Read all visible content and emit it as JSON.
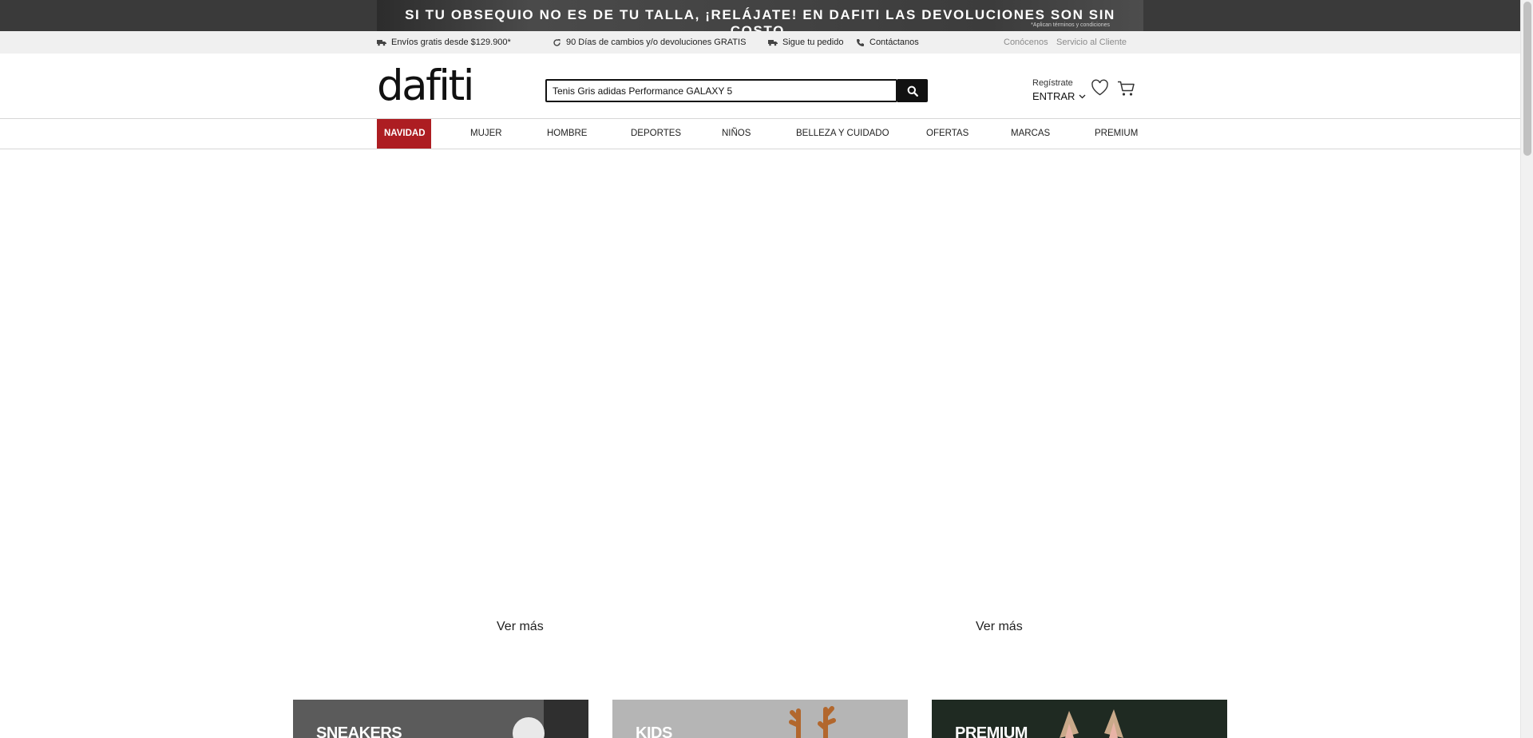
{
  "promo": {
    "text": "SI TU OBSEQUIO NO ES DE TU TALLA, ¡RELÁJATE! EN DAFITI LAS DEVOLUCIONES SON SIN COSTO.",
    "subtext": "*Aplican términos y condiciones"
  },
  "infobar": {
    "shipping": "Envíos gratis desde $129.900*",
    "returns": "90 Días de cambios y/o devoluciones GRATIS",
    "tracking": "Sigue tu pedido",
    "contact": "Contáctanos",
    "about": "Conócenos",
    "service": "Servicio al Cliente"
  },
  "header": {
    "logo": "dafiti",
    "search_value": "Tenis Gris adidas Performance GALAXY 5",
    "register": "Regístrate",
    "login": "ENTRAR"
  },
  "nav": {
    "items": [
      "NAVIDAD",
      "MUJER",
      "HOMBRE",
      "DEPORTES",
      "NIÑOS",
      "BELLEZA Y CUIDADO",
      "OFERTAS",
      "MARCAS",
      "PREMIUM"
    ]
  },
  "main": {
    "ver_mas_left": "Ver más",
    "ver_mas_right": "Ver más",
    "tiles": [
      "SNEAKERS",
      "KIDS",
      "PREMIUM"
    ]
  },
  "colors": {
    "accent": "#ad1d22",
    "promo_bg": "#3a3a3a",
    "infobar_bg": "#f0f0f0"
  },
  "icons": {
    "truck": "truck-icon",
    "refresh": "refresh-icon",
    "tracking": "truck-icon",
    "phone": "phone-icon",
    "search": "search-icon",
    "chevron": "chevron-down-icon",
    "wishlist": "heart-icon",
    "cart": "cart-icon"
  }
}
